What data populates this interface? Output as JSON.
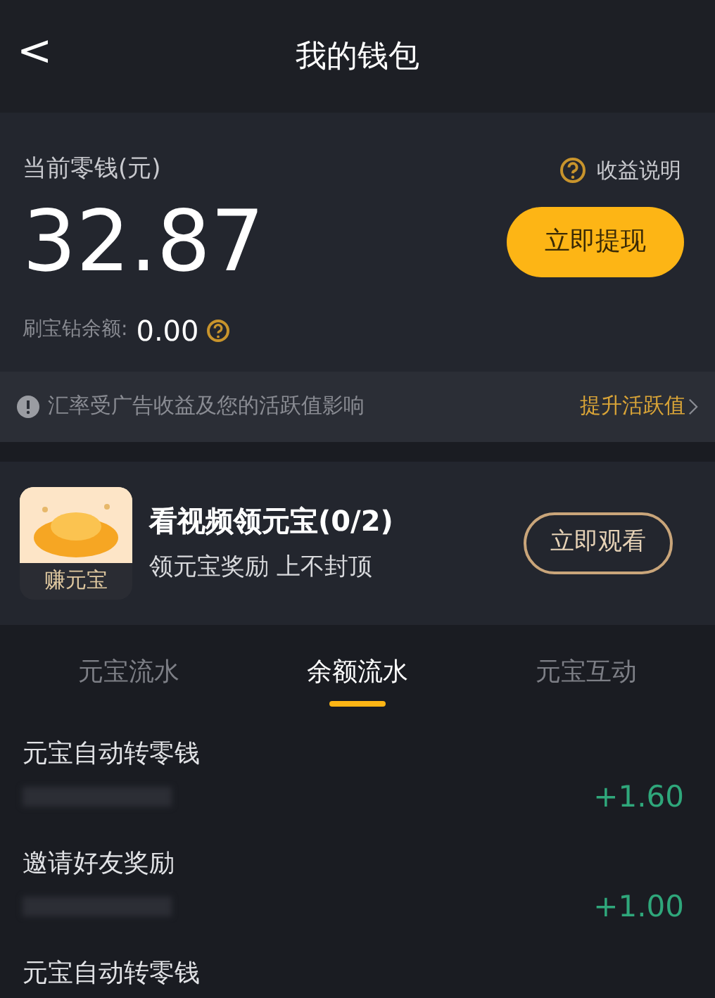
{
  "header": {
    "back": "<",
    "title": "我的钱包"
  },
  "balance": {
    "label": "当前零钱(元)",
    "help_link": "收益说明",
    "amount": "32.87",
    "withdraw_button": "立即提现",
    "diamond_label": "刷宝钻余额:",
    "diamond_value": "0.00"
  },
  "notice": {
    "text": "汇率受广告收益及您的活跃值影响",
    "link": "提升活跃值"
  },
  "task": {
    "badge": "赚元宝",
    "title": "看视频领元宝(0/2)",
    "subtitle": "领元宝奖励 上不封顶",
    "button": "立即观看"
  },
  "tabs": [
    {
      "label": "元宝流水",
      "selected": false
    },
    {
      "label": "余额流水",
      "selected": true
    },
    {
      "label": "元宝互动",
      "selected": false
    }
  ],
  "records": [
    {
      "title": "元宝自动转零钱",
      "amount": "+1.60"
    },
    {
      "title": "邀请好友奖励",
      "amount": "+1.00"
    },
    {
      "title": "元宝自动转零钱"
    }
  ]
}
